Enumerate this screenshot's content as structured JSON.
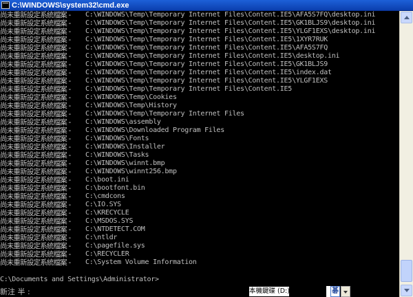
{
  "window": {
    "title": "C:\\WINDOWS\\system32\\cmd.exe"
  },
  "console": {
    "status_text": "尚未重新設定系統檔案 - ",
    "lines": [
      "C:\\WINDOWS\\Temp\\Temporary Internet Files\\Content.IE5\\AFA5S7FQ\\desktop.ini",
      "C:\\WINDOWS\\Temp\\Temporary Internet Files\\Content.IE5\\GK1BLJS9\\desktop.ini",
      "C:\\WINDOWS\\Temp\\Temporary Internet Files\\Content.IE5\\YLGF1EXS\\desktop.ini",
      "C:\\WINDOWS\\Temp\\Temporary Internet Files\\Content.IE5\\1XYR7RUK",
      "C:\\WINDOWS\\Temp\\Temporary Internet Files\\Content.IE5\\AFA5S7FQ",
      "C:\\WINDOWS\\Temp\\Temporary Internet Files\\Content.IE5\\desktop.ini",
      "C:\\WINDOWS\\Temp\\Temporary Internet Files\\Content.IE5\\GK1BLJS9",
      "C:\\WINDOWS\\Temp\\Temporary Internet Files\\Content.IE5\\index.dat",
      "C:\\WINDOWS\\Temp\\Temporary Internet Files\\Content.IE5\\YLGF1EXS",
      "C:\\WINDOWS\\Temp\\Temporary Internet Files\\Content.IE5",
      "C:\\WINDOWS\\Temp\\Cookies",
      "C:\\WINDOWS\\Temp\\History",
      "C:\\WINDOWS\\Temp\\Temporary Internet Files",
      "C:\\WINDOWS\\assembly",
      "C:\\WINDOWS\\Downloaded Program Files",
      "C:\\WINDOWS\\Fonts",
      "C:\\WINDOWS\\Installer",
      "C:\\WINDOWS\\Tasks",
      "C:\\WINDOWS\\winnt.bmp",
      "C:\\WINDOWS\\winnt256.bmp",
      "C:\\boot.ini",
      "C:\\bootfont.bin",
      "C:\\cmdcons",
      "C:\\IO.SYS",
      "C:\\KRECYCLE",
      "C:\\MSDOS.SYS",
      "C:\\NTDETECT.COM",
      "C:\\ntldr",
      "C:\\pagefile.sys",
      "C:\\RECYCLER",
      "C:\\System Volume Information"
    ],
    "prompt": "C:\\Documents and Settings\\Administrator>"
  },
  "ime": {
    "mode_text": "新注 半 :",
    "name": "本機鍵碟 (D:)",
    "button_label": "碁"
  }
}
